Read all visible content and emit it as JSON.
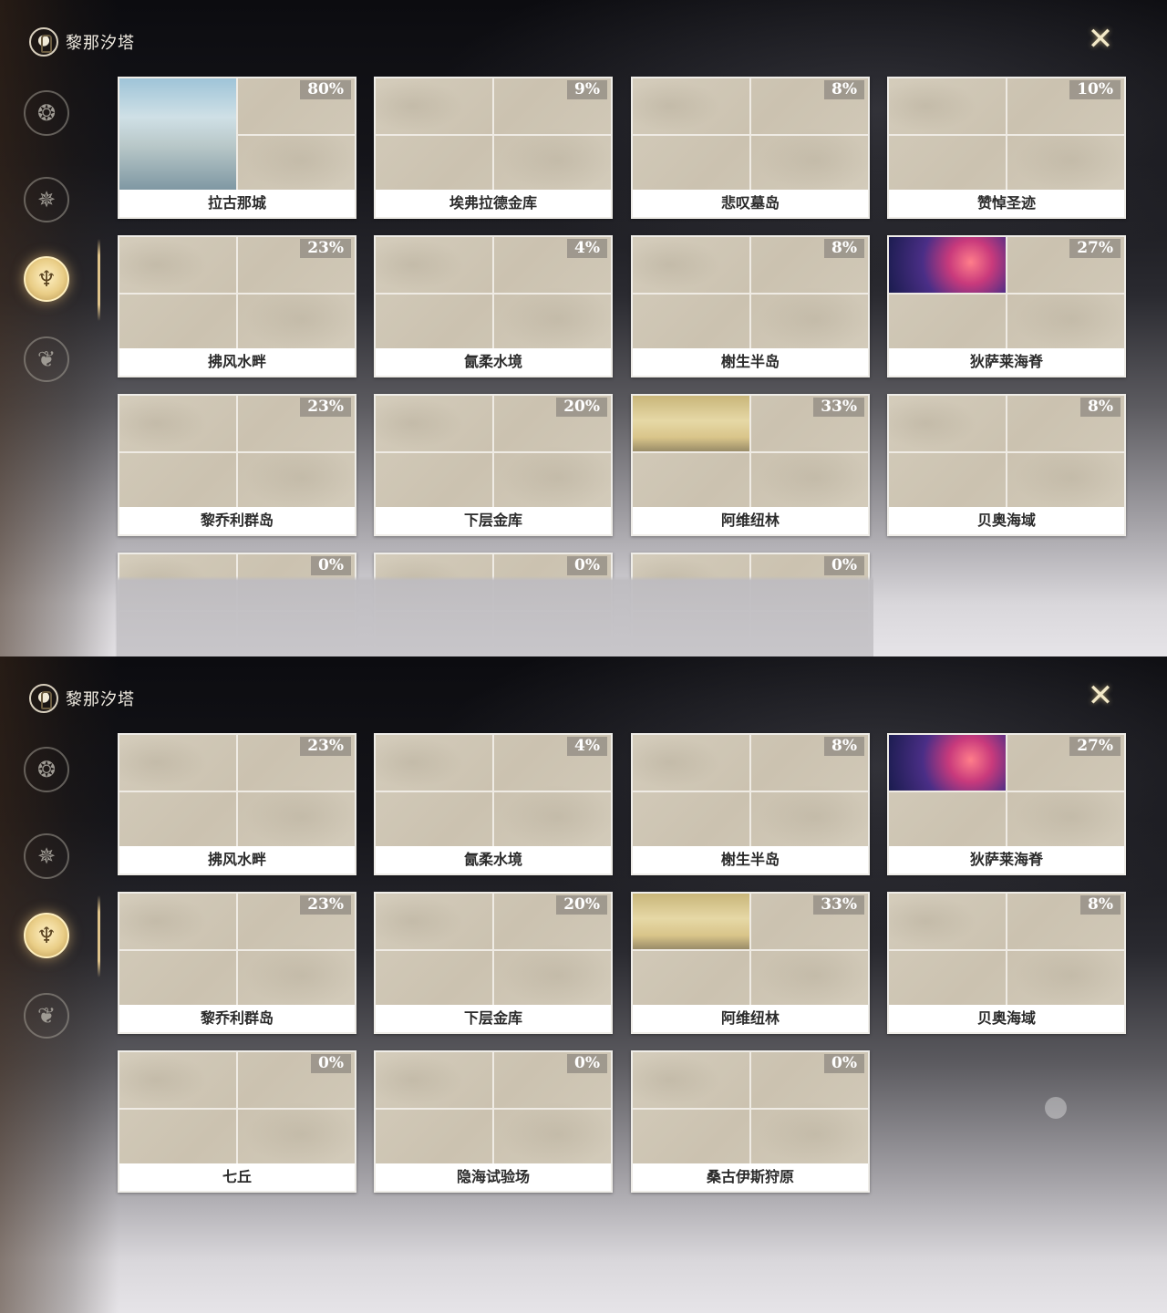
{
  "header": {
    "title": "黎那汐塔"
  },
  "sidebar": {
    "items": [
      {
        "icon": "dragon-emblem-icon",
        "glyph": "❂"
      },
      {
        "icon": "star-emblem-icon",
        "glyph": "✵"
      },
      {
        "icon": "rinascita-emblem-icon",
        "glyph": "♆"
      },
      {
        "icon": "wing-emblem-icon",
        "glyph": "❦"
      }
    ],
    "active_index": 2
  },
  "close_icon": "✕",
  "top_panel": {
    "cards": [
      {
        "name": "拉古那城",
        "pct": "80%",
        "thumb": "city"
      },
      {
        "name": "埃弗拉德金库",
        "pct": "9%"
      },
      {
        "name": "悲叹墓岛",
        "pct": "8%"
      },
      {
        "name": "赞悼圣迹",
        "pct": "10%"
      },
      {
        "name": "拂风水畔",
        "pct": "23%"
      },
      {
        "name": "氤柔水境",
        "pct": "4%"
      },
      {
        "name": "榭生半岛",
        "pct": "8%"
      },
      {
        "name": "狄萨莱海脊",
        "pct": "27%",
        "thumb": "nebula"
      },
      {
        "name": "黎乔利群岛",
        "pct": "23%"
      },
      {
        "name": "下层金库",
        "pct": "20%"
      },
      {
        "name": "阿维纽林",
        "pct": "33%",
        "thumb": "desert"
      },
      {
        "name": "贝奥海域",
        "pct": "8%"
      },
      {
        "name": "",
        "pct": "0%"
      },
      {
        "name": "",
        "pct": "0%"
      },
      {
        "name": "",
        "pct": "0%"
      }
    ]
  },
  "bottom_panel": {
    "cards": [
      {
        "name": "拂风水畔",
        "pct": "23%"
      },
      {
        "name": "氤柔水境",
        "pct": "4%"
      },
      {
        "name": "榭生半岛",
        "pct": "8%"
      },
      {
        "name": "狄萨莱海脊",
        "pct": "27%",
        "thumb": "nebula"
      },
      {
        "name": "黎乔利群岛",
        "pct": "23%"
      },
      {
        "name": "下层金库",
        "pct": "20%"
      },
      {
        "name": "阿维纽林",
        "pct": "33%",
        "thumb": "desert"
      },
      {
        "name": "贝奥海域",
        "pct": "8%"
      },
      {
        "name": "七丘",
        "pct": "0%"
      },
      {
        "name": "隐海试验场",
        "pct": "0%"
      },
      {
        "name": "桑古伊斯狩原",
        "pct": "0%"
      }
    ]
  }
}
